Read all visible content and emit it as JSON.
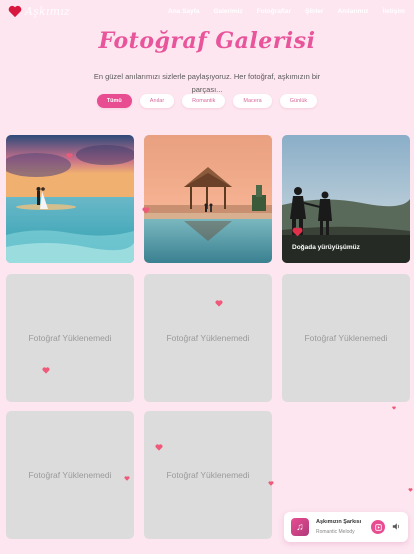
{
  "nav": {
    "logo_text": "Aşkımız",
    "links": [
      "Ana Sayfa",
      "Galerimiz",
      "Fotoğraflar",
      "Şiirler",
      "Anılarımız",
      "İletişim"
    ],
    "active_index": 3
  },
  "header": {
    "title": "Fotoğraf Galerisi",
    "subtitle": "En güzel anılarımızı sizlerle paylaşıyoruz. Her fotoğraf, aşkımızın bir parçası..."
  },
  "filters": [
    "Tümü",
    "Anılar",
    "Romantik",
    "Macera",
    "Günlük"
  ],
  "active_filter": "Tümü",
  "gallery": {
    "photos": [
      {
        "type": "beach-couple"
      },
      {
        "type": "resort-gazebo"
      },
      {
        "type": "walking-couple",
        "caption": "Doğada yürüyüşümüz"
      }
    ],
    "placeholder_text": "Fotoğraf Yüklenemedi"
  },
  "player": {
    "title": "Aşkımızın Şarkısı",
    "artist": "Romantic Melody",
    "icons": [
      "music-note-icon",
      "play-icon",
      "volume-icon"
    ]
  },
  "colors": {
    "accent": "#e84d92",
    "background": "#fde6f0",
    "placeholder": "#dcdcdc"
  }
}
